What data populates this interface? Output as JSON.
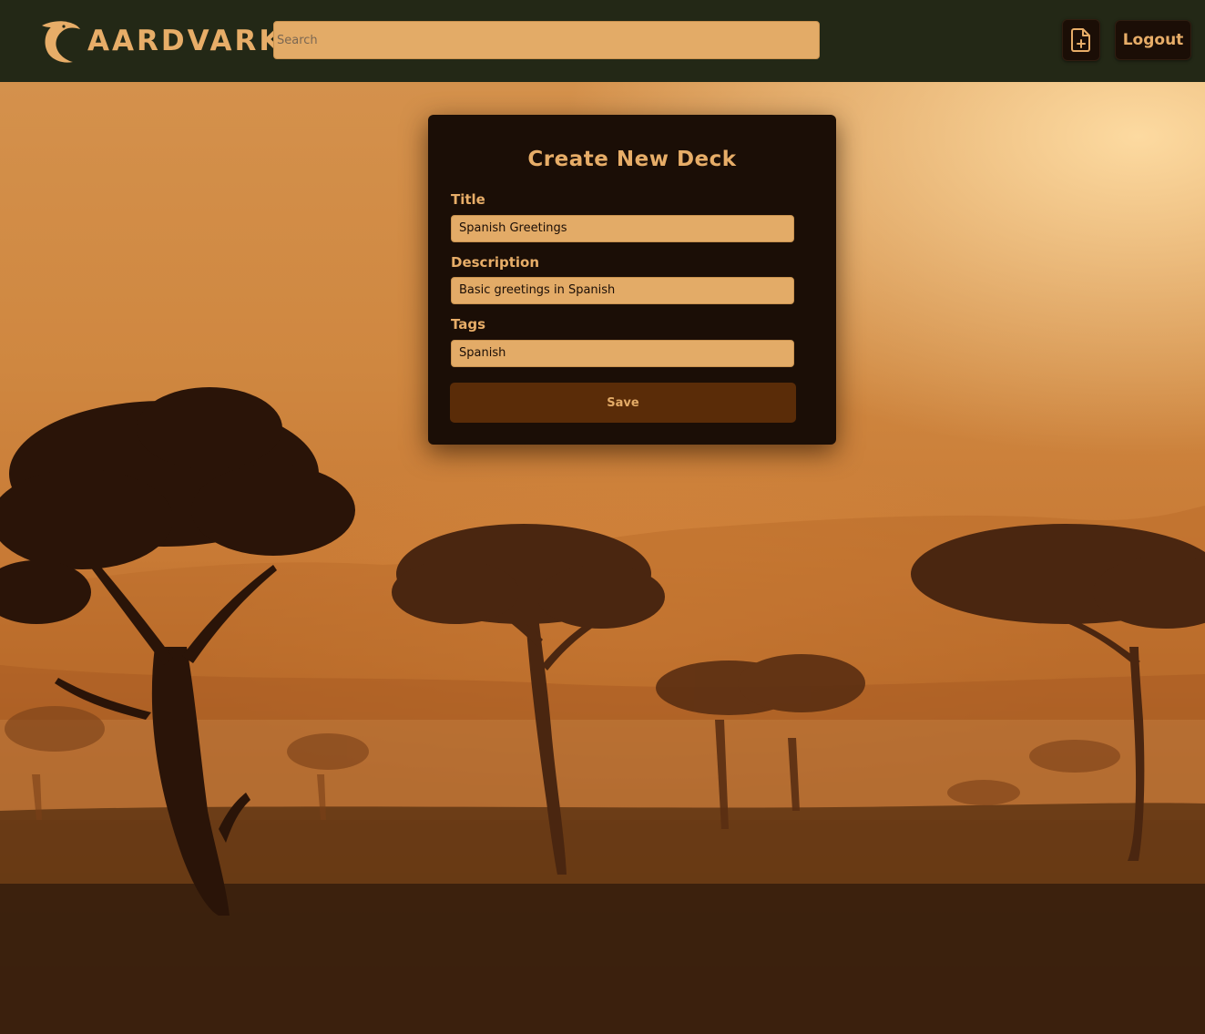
{
  "app": {
    "name": "AARDVARK"
  },
  "header": {
    "search": {
      "placeholder": "Search",
      "value": ""
    },
    "new_deck_icon": "file-plus-icon",
    "logout_label": "Logout"
  },
  "form": {
    "title": "Create New Deck",
    "fields": [
      {
        "label": "Title",
        "value": "Spanish Greetings"
      },
      {
        "label": "Description",
        "value": "Basic greetings in Spanish"
      },
      {
        "label": "Tags",
        "value": "Spanish"
      }
    ],
    "save_label": "Save"
  },
  "colors": {
    "header_bg": "#232816",
    "accent": "#e7ad68",
    "card_bg": "#1b0e06",
    "save_bg": "#5a2c08"
  }
}
